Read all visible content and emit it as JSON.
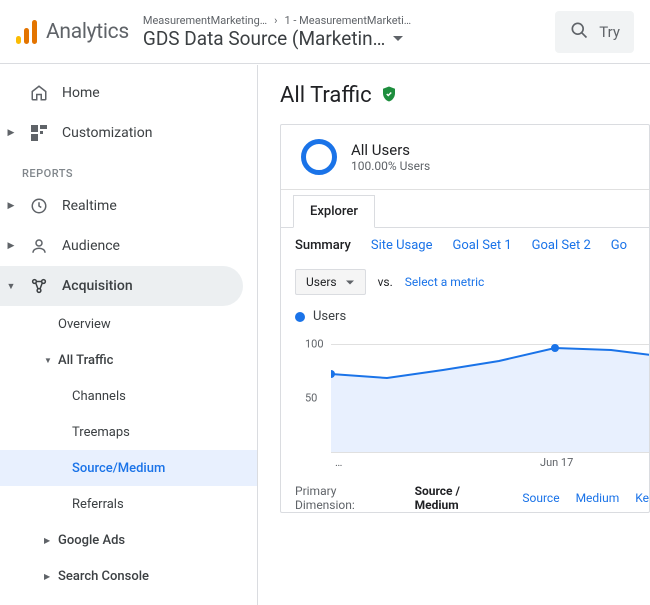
{
  "logo_text": "Analytics",
  "breadcrumb": {
    "a": "MeasurementMarketing…",
    "b": "1 - MeasurementMarketi…"
  },
  "page_selector": "GDS Data Source (Marketin…",
  "search_placeholder": "Try",
  "sidebar": {
    "home": "Home",
    "customization": "Customization",
    "reports_header": "REPORTS",
    "realtime": "Realtime",
    "audience": "Audience",
    "acquisition": "Acquisition",
    "overview": "Overview",
    "all_traffic": "All Traffic",
    "channels": "Channels",
    "treemaps": "Treemaps",
    "source_medium": "Source/Medium",
    "referrals": "Referrals",
    "google_ads": "Google Ads",
    "search_console": "Search Console"
  },
  "content": {
    "page_title": "All Traffic",
    "segment": {
      "title": "All Users",
      "sub": "100.00% Users"
    },
    "tab": "Explorer",
    "subtabs": [
      "Summary",
      "Site Usage",
      "Goal Set 1",
      "Goal Set 2",
      "Go"
    ],
    "metric_dd": "Users",
    "vs": "vs.",
    "select_metric": "Select a metric",
    "legend": "Users",
    "primary_dim_label": "Primary Dimension:",
    "primary_dims": [
      "Source / Medium",
      "Source",
      "Medium",
      "Ke"
    ]
  },
  "chart_data": {
    "type": "line",
    "ylabel": "",
    "ylim": [
      0,
      110
    ],
    "y_ticks": [
      50,
      100
    ],
    "x_ticks": [
      "…",
      "Jun 17"
    ],
    "series": [
      {
        "name": "Users",
        "color": "#1a73e8",
        "values": [
          72,
          68,
          76,
          84,
          96,
          94,
          88
        ]
      }
    ]
  }
}
